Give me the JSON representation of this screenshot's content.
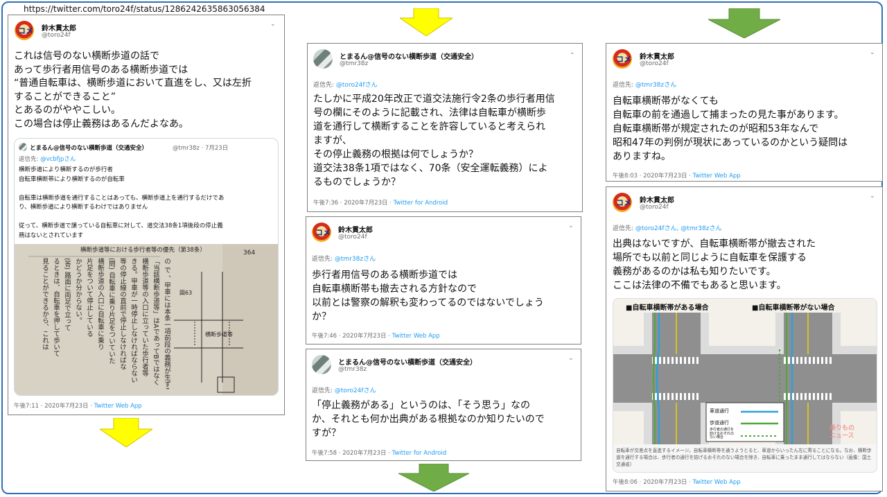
{
  "source_url": "https://twitter.com/toro24f/status/1286242635863056384",
  "tweets": {
    "t1": {
      "name": "鈴木貫太郎",
      "handle": "@toro24f",
      "body": "これは信号のない横断歩道の話で\nあって歩行者用信号のある横断歩道では\n“普通自転車は、横断歩道において直進をし、又は左折\nすることができること”\nとあるのがややこしい。\nこの場合は停止義務はあるんだよなあ。",
      "meta": "午後7:11 · 2020年7月23日 · ",
      "source": "Twitter Web App",
      "quote": {
        "name": "とまるん@信号のない横断歩道（交通安全）",
        "handle_date": "@tmr38z · 7月23日",
        "reply_label": "返信先: ",
        "reply_to": "@vcbfjpさん",
        "lines": [
          "横断歩道により横断するのが歩行者",
          "自転車横断帯により横断するのが自転車",
          "",
          "自転車は横断歩道を通行することはあっても、横断歩道上を通行するだけであ",
          "り、横断歩道により横断するわけではありません",
          "",
          "従って、横断歩道で譲っている自転車に対して、道交法38条1項後段の停止義",
          "務はないとされています"
        ],
        "book_header": "横断歩道等における歩行者等の優先（第38条）",
        "book_page": "364",
        "book_fig_label": "横断歩道等",
        "book_fig_num": "図63",
        "book_col_text": [
          "の で 、甲車には本条一項前段の義務が生ずる",
          "「当該横断歩道等」はAであってBではなく",
          "横断歩道等の入口に立っていた歩行者等",
          "きる。甲車が一時停止しなければならない",
          "等の停止線の直前で停止しなければな",
          "(問) 自転車に乗り片足をついていた",
          "横断歩道の入口に自転車に乗り",
          "片足をついて停止している",
          "かどうか分からない。",
          "(答) 路面に両足で立って",
          "るときは、自転車を押して歩いて",
          "見ることができるから、これは"
        ]
      }
    },
    "t2": {
      "name": "とまるん@信号のない横断歩道（交通安全）",
      "handle": "@tmr38z",
      "reply_label": "返信先: ",
      "reply_to": "@toro24fさん",
      "body": "たしかに平成20年改正で道交法施行令2条の歩行者用信\n号の欄にそのように記載され、法律は自転車が横断歩\n道を通行して横断することを許容していると考えられ\nますが、\nその停止義務の根拠は何でしょうか？\n道交法38条1項ではなく、70条（安全運転義務）によ\nるものでしょうか？",
      "meta": "午後7:36 · 2020年7月23日 · ",
      "source": "Twitter for Android"
    },
    "t3": {
      "name": "鈴木貫太郎",
      "handle": "@toro24f",
      "reply_label": "返信先: ",
      "reply_to": "@tmr38zさん",
      "body": "歩行者用信号のある横断歩道では\n自転車横断帯も撤去される方針なので\n以前とは警察の解釈も変わってるのではないでしょう\nか？",
      "meta": "午後7:46 · 2020年7月23日 · ",
      "source": "Twitter Web App"
    },
    "t4": {
      "name": "とまるん@信号のない横断歩道（交通安全）",
      "handle": "@tmr38z",
      "reply_label": "返信先: ",
      "reply_to": "@toro24fさん",
      "body": "「停止義務がある」というのは、「そう思う」なの\nか、それとも何か出典がある根拠なのか知りたいので\nすが？",
      "meta": "午後7:58 · 2020年7月23日 · ",
      "source": "Twitter for Android"
    },
    "t5": {
      "name": "鈴木貫太郎",
      "handle": "@toro24f",
      "reply_label": "返信先: ",
      "reply_to": "@tmr38zさん",
      "body": "自転車横断帯がなくても\n自転車の前を通過して捕まったの見た事があります。\n自転車横断帯が規定されたのが昭和53年なんで\n昭和47年の判例が現状にあっているのかという疑問は\nありますね。",
      "meta": "午後8:03 · 2020年7月23日 · ",
      "source": "Twitter Web App"
    },
    "t6": {
      "name": "鈴木貫太郎",
      "handle": "@toro24f",
      "reply_label": "返信先: ",
      "reply_to": "@toro24fさん, @tmr38zさん",
      "body": "出典はないですが、自転車横断帯が撤去された\n場所でも以前と同じように自転車を保護する\n義務があるのかは私も知りたいです。\nここは法律の不備でもあると思います。",
      "meta": "午後8:06 · 2020年7月23日 · ",
      "source": "Twitter Web App",
      "figure": {
        "left_title": "■自転車横断帯がある場合",
        "right_title": "■自転車横断帯がない場合",
        "legend": [
          "車道通行",
          "歩道通行",
          "歩行者の通行を\n妨げるおそれの\nない場合"
        ],
        "watermark": "乗りもの\nニュース",
        "caption": "自転車が交差点を直進するイメージ。自転車横断帯を通うようとると、車道からいったん左に寄ることになる。なお、横断歩道を通行する場合は、歩行者の通行を妨げるおそれのない場合を除き、自転車に乗ったまま通行してはならない（画像：国土交通省）"
      }
    }
  },
  "colors": {
    "yellow_arrow": "#ffff00",
    "green_arrow": "#70ad47",
    "frame": "#2f6fb7",
    "link": "#1d9bf0",
    "bike_lane": "#2e9fd8",
    "sidewalk_lane": "#4fa83a"
  }
}
